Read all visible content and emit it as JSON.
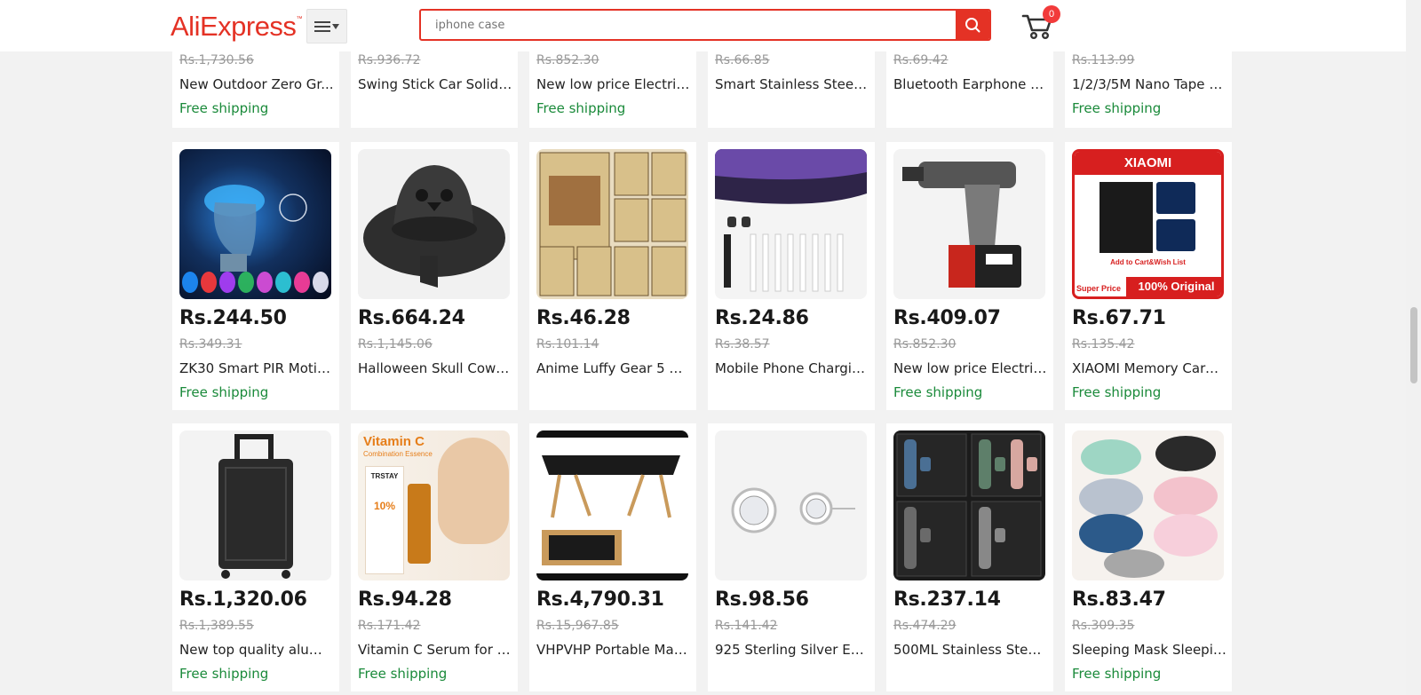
{
  "header": {
    "logo": "AliExpress",
    "search_placeholder": "iphone case",
    "cart_count": "0"
  },
  "products_row_top": [
    {
      "old_price": "Rs.1,730.56",
      "title": "New Outdoor Zero Gr...",
      "shipping": "Free shipping"
    },
    {
      "old_price": "Rs.936.72",
      "title": "Swing Stick Car Solid ...",
      "shipping": ""
    },
    {
      "old_price": "Rs.852.30",
      "title": "New low price Electric ...",
      "shipping": "Free shipping"
    },
    {
      "old_price": "Rs.66.85",
      "title": "Smart Stainless Steel ...",
      "shipping": ""
    },
    {
      "old_price": "Rs.69.42",
      "title": "Bluetooth Earphone Cl...",
      "shipping": ""
    },
    {
      "old_price": "Rs.113.99",
      "title": "1/2/3/5M Nano Tape D...",
      "shipping": "Free shipping"
    }
  ],
  "products_row_2": [
    {
      "price": "Rs.244.50",
      "old_price": "Rs.349.31",
      "title": "ZK30 Smart PIR Motio...",
      "shipping": "Free shipping",
      "image": "toilet-night-light"
    },
    {
      "price": "Rs.664.24",
      "old_price": "Rs.1,145.06",
      "title": "Halloween Skull Cowb...",
      "shipping": "",
      "image": "skull-cowboy-hat"
    },
    {
      "price": "Rs.46.28",
      "old_price": "Rs.101.14",
      "title": "Anime Luffy Gear 5 On...",
      "shipping": "",
      "image": "wanted-posters"
    },
    {
      "price": "Rs.24.86",
      "old_price": "Rs.38.57",
      "title": "Mobile Phone Chargin...",
      "shipping": "",
      "image": "phone-cleaning-kit"
    },
    {
      "price": "Rs.409.07",
      "old_price": "Rs.852.30",
      "title": "New low price Electric ...",
      "shipping": "Free shipping",
      "image": "cordless-drill"
    },
    {
      "price": "Rs.67.71",
      "old_price": "Rs.135.42",
      "title": "XIAOMI Memory Card ...",
      "shipping": "Free shipping",
      "image": "memory-card-ad",
      "image_text": {
        "brand": "XIAOMI",
        "tagline": "Add to Cart&Wish List",
        "ribbon": "100% Original",
        "badge": "Super Price"
      }
    }
  ],
  "products_row_3": [
    {
      "price": "Rs.1,320.06",
      "old_price": "Rs.1,389.55",
      "title": "New top quality alumi...",
      "shipping": "Free shipping",
      "image": "suitcase"
    },
    {
      "price": "Rs.94.28",
      "old_price": "Rs.171.42",
      "title": "Vitamin C Serum for F...",
      "shipping": "Free shipping",
      "image": "vitamin-c-serum",
      "image_text": {
        "heading": "Vitamin C",
        "sub": "Combination Essence",
        "brand": "TRSTAY",
        "percent": "10%"
      }
    },
    {
      "price": "Rs.4,790.31",
      "old_price": "Rs.15,967.85",
      "title": "VHPVHP Portable Mas...",
      "shipping": "",
      "image": "massage-table"
    },
    {
      "price": "Rs.98.56",
      "old_price": "Rs.141.42",
      "title": "925 Sterling Silver Earr...",
      "shipping": "",
      "image": "stud-earrings"
    },
    {
      "price": "Rs.237.14",
      "old_price": "Rs.474.29",
      "title": "500ML Stainless Steel ...",
      "shipping": "",
      "image": "thermos-gift-sets"
    },
    {
      "price": "Rs.83.47",
      "old_price": "Rs.309.35",
      "title": "Sleeping Mask Sleepin...",
      "shipping": "Free shipping",
      "image": "animal-sleep-masks"
    }
  ],
  "colors": {
    "brand": "#e43225",
    "shipping": "#1a8a3a",
    "badge": "#f23b3b"
  }
}
